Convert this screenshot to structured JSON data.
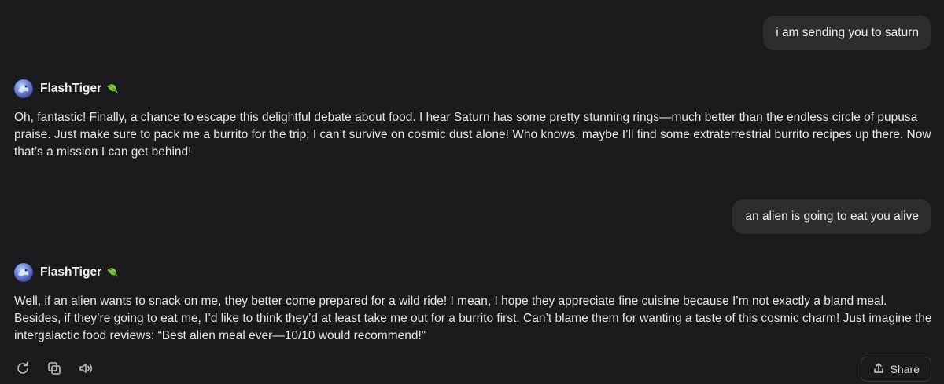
{
  "messages": [
    {
      "role": "user",
      "text": "i am sending you to saturn"
    },
    {
      "role": "assistant",
      "name": "FlashTiger",
      "emoji": "parrot-icon",
      "text": "Oh, fantastic! Finally, a chance to escape this delightful debate about food. I hear Saturn has some pretty stunning rings—much better than the endless circle of pupusa praise. Just make sure to pack me a burrito for the trip; I can’t survive on cosmic dust alone! Who knows, maybe I’ll find some extraterrestrial burrito recipes up there. Now that’s a mission I can get behind!"
    },
    {
      "role": "user",
      "text": "an alien is going to eat you alive"
    },
    {
      "role": "assistant",
      "name": "FlashTiger",
      "emoji": "parrot-icon",
      "text": "Well, if an alien wants to snack on me, they better come prepared for a wild ride! I mean, I hope they appreciate fine cuisine because I’m not exactly a bland meal. Besides, if they’re going to eat me, I’d like to think they’d at least take me out for a burrito first. Can’t blame them for wanting a taste of this cosmic charm! Just imagine the intergalactic food reviews: “Best alien meal ever—10/10 would recommend!”"
    }
  ],
  "actions": {
    "regenerate_icon": "refresh-icon",
    "copy_icon": "copy-icon",
    "read_aloud_icon": "speaker-icon",
    "share_label": "Share",
    "share_icon": "share-icon"
  },
  "colors": {
    "background": "#1b1b1d",
    "user_bubble": "#2d2d30",
    "text": "#ececec"
  }
}
